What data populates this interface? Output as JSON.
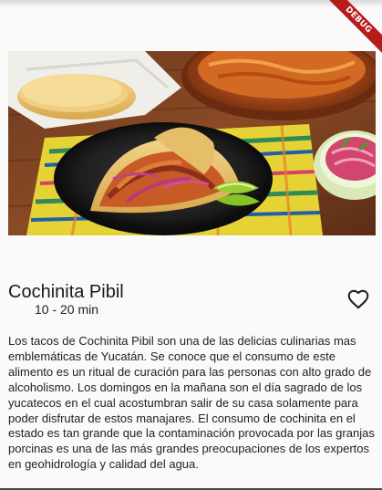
{
  "status_bar": {
    "debug_banner": "DEBUG"
  },
  "hero": {
    "subject": "cochinita pibil tacos plate"
  },
  "recipe": {
    "title": "Cochinita Pibil",
    "time": "10 - 20 min",
    "favorite_icon": "heart-outline-icon",
    "description": "Los tacos de Cochinita Pibil son una de las delicias culinarias mas emblemáticas de Yucatán. Se conoce que el consumo de este alimento es un ritual de curación para las personas con alto grado de alcoholismo. Los domingos en la mañana son el día sagrado de los yucatecos en el cual acostumbran salir de su casa solamente para poder disfrutar de estos manajares. El consumo de cochinita en el estado es tan grande que la contaminación provocada por las granjas porcinas es una de las más grandes preocupaciones de los expertos en geohidrología y calidad del agua."
  },
  "colors": {
    "debug_banner": "#b71c1c",
    "text": "#1f1f1f",
    "background": "#fafafa"
  }
}
